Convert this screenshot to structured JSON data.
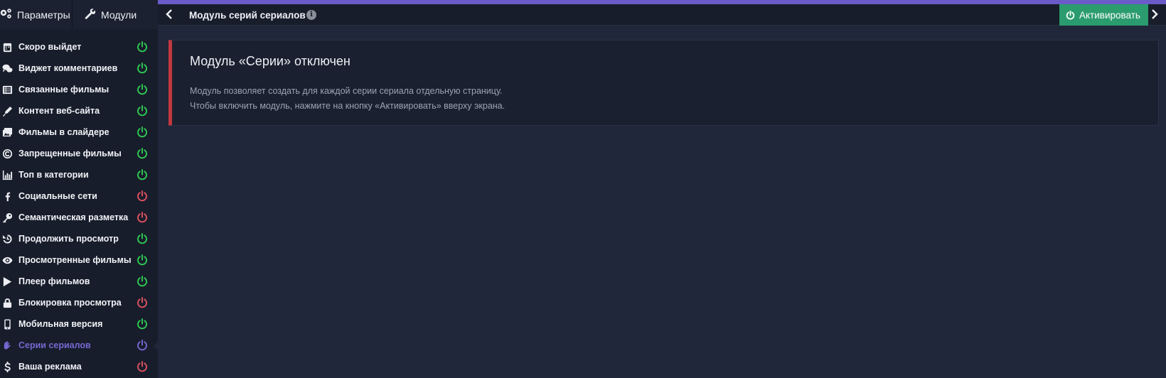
{
  "sidebar": {
    "tabs": [
      {
        "label": "Параметры",
        "icon": "gears-icon"
      },
      {
        "label": "Модули",
        "icon": "wrench-icon"
      }
    ],
    "items": [
      {
        "label": "Скоро выйдет",
        "icon": "calendar-icon",
        "status": "on"
      },
      {
        "label": "Виджет комментариев",
        "icon": "comments-icon",
        "status": "on"
      },
      {
        "label": "Связанные фильмы",
        "icon": "list-icon",
        "status": "on"
      },
      {
        "label": "Контент веб-сайта",
        "icon": "pen-icon",
        "status": "on"
      },
      {
        "label": "Фильмы в слайдере",
        "icon": "images-icon",
        "status": "on"
      },
      {
        "label": "Запрещенные фильмы",
        "icon": "copyright-icon",
        "status": "on"
      },
      {
        "label": "Топ в категории",
        "icon": "bar-chart-icon",
        "status": "on"
      },
      {
        "label": "Социальные сети",
        "icon": "facebook-icon",
        "status": "off"
      },
      {
        "label": "Семантическая разметка",
        "icon": "key-icon",
        "status": "off"
      },
      {
        "label": "Продолжить просмотр",
        "icon": "history-icon",
        "status": "on"
      },
      {
        "label": "Просмотренные фильмы",
        "icon": "eye-icon",
        "status": "on"
      },
      {
        "label": "Плеер фильмов",
        "icon": "play-icon",
        "status": "on"
      },
      {
        "label": "Блокировка просмотра",
        "icon": "lock-icon",
        "status": "off"
      },
      {
        "label": "Мобильная версия",
        "icon": "mobile-icon",
        "status": "on"
      },
      {
        "label": "Серии сериалов",
        "icon": "hand-icon",
        "status": "active"
      },
      {
        "label": "Ваша реклама",
        "icon": "dollar-icon",
        "status": "off"
      }
    ]
  },
  "topbar": {
    "title": "Модуль серий сериалов",
    "info_icon": "i",
    "activate_label": "Активировать"
  },
  "notice": {
    "title": "Модуль «Серии» отключен",
    "line1": "Модуль позволяет создать для каждой серии сериала отдельную страницу.",
    "line2": "Чтобы включить модуль, нажмите на кнопку «Активировать» вверху экрана."
  },
  "colors": {
    "accent": "#6a5bc9",
    "on": "#2ecc52",
    "off": "#e05260",
    "active": "#7668d2",
    "activate_button": "#2b9c6e",
    "alert_border": "#c2383f"
  }
}
